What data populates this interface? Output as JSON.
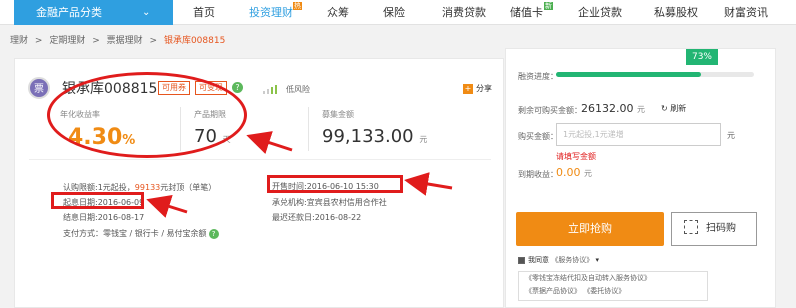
{
  "nav": {
    "category": "金融产品分类",
    "items": [
      {
        "label": "首页"
      },
      {
        "label": "投资理财",
        "badge": "热",
        "active": true
      },
      {
        "label": "众筹"
      },
      {
        "label": "保险"
      },
      {
        "label": "消费贷款"
      },
      {
        "label": "储值卡",
        "badge": "新"
      },
      {
        "label": "企业贷款"
      },
      {
        "label": "私募股权"
      },
      {
        "label": "财富资讯"
      }
    ]
  },
  "breadcrumb": [
    "理财",
    ">",
    "定期理财",
    ">",
    "票据理财",
    ">",
    "银承库008815"
  ],
  "product": {
    "icon_text": "票",
    "name": "银承库008815",
    "chips": [
      "可用券",
      "可变现"
    ],
    "risk": "低风险",
    "share": "分享",
    "rate_label": "年化收益率",
    "rate_value": "4.30",
    "rate_unit": "%",
    "period_label": "产品期限",
    "period_value": "70",
    "period_unit": "天",
    "amount_label": "募集金额",
    "amount_value": "99,133.00",
    "amount_unit": "元"
  },
  "details": {
    "min_invest": "认购限额:1元起投，",
    "limit_value": "99133",
    "limit_suffix": "元封顶（单笔）",
    "start_date": "起息日期:2016-06-09",
    "end_date": "结息日期:2016-08-17",
    "payment": "支付方式：零钱宝 / 银行卡 / 易付宝余额",
    "open_time": "开售时间:2016-06-10 15:30",
    "issuer": "承兑机构:宜宾县农村信用合作社",
    "repay_date": "最迟还款日:2016-08-22"
  },
  "purchase": {
    "progress_label": "融资进度：",
    "progress_pct": "73%",
    "progress_value": 0.73,
    "remain_label": "剩余可购买金额：",
    "remain_value": "26132.00",
    "remain_unit": "元",
    "refresh": "刷新",
    "buy_label": "购买金额：",
    "buy_placeholder": "1元起投,1元递增",
    "buy_unit": "元",
    "error": "请填写金额",
    "income_label": "到期收益：",
    "income_value": "0.00",
    "income_unit": "元",
    "buy_button": "立即抢购",
    "scan_button": "扫码购",
    "agree_text": "我同意",
    "agree_link": "《服务协议》",
    "agreements": [
      "《零钱宝冻结代扣及自动转入服务协议》",
      "《票据产品协议》 《委托协议》"
    ]
  },
  "colors": {
    "brand_blue": "#2f9fe0",
    "accent_orange": "#f08b14",
    "progress_green": "#22b573",
    "annotation_red": "#e01c1c"
  }
}
